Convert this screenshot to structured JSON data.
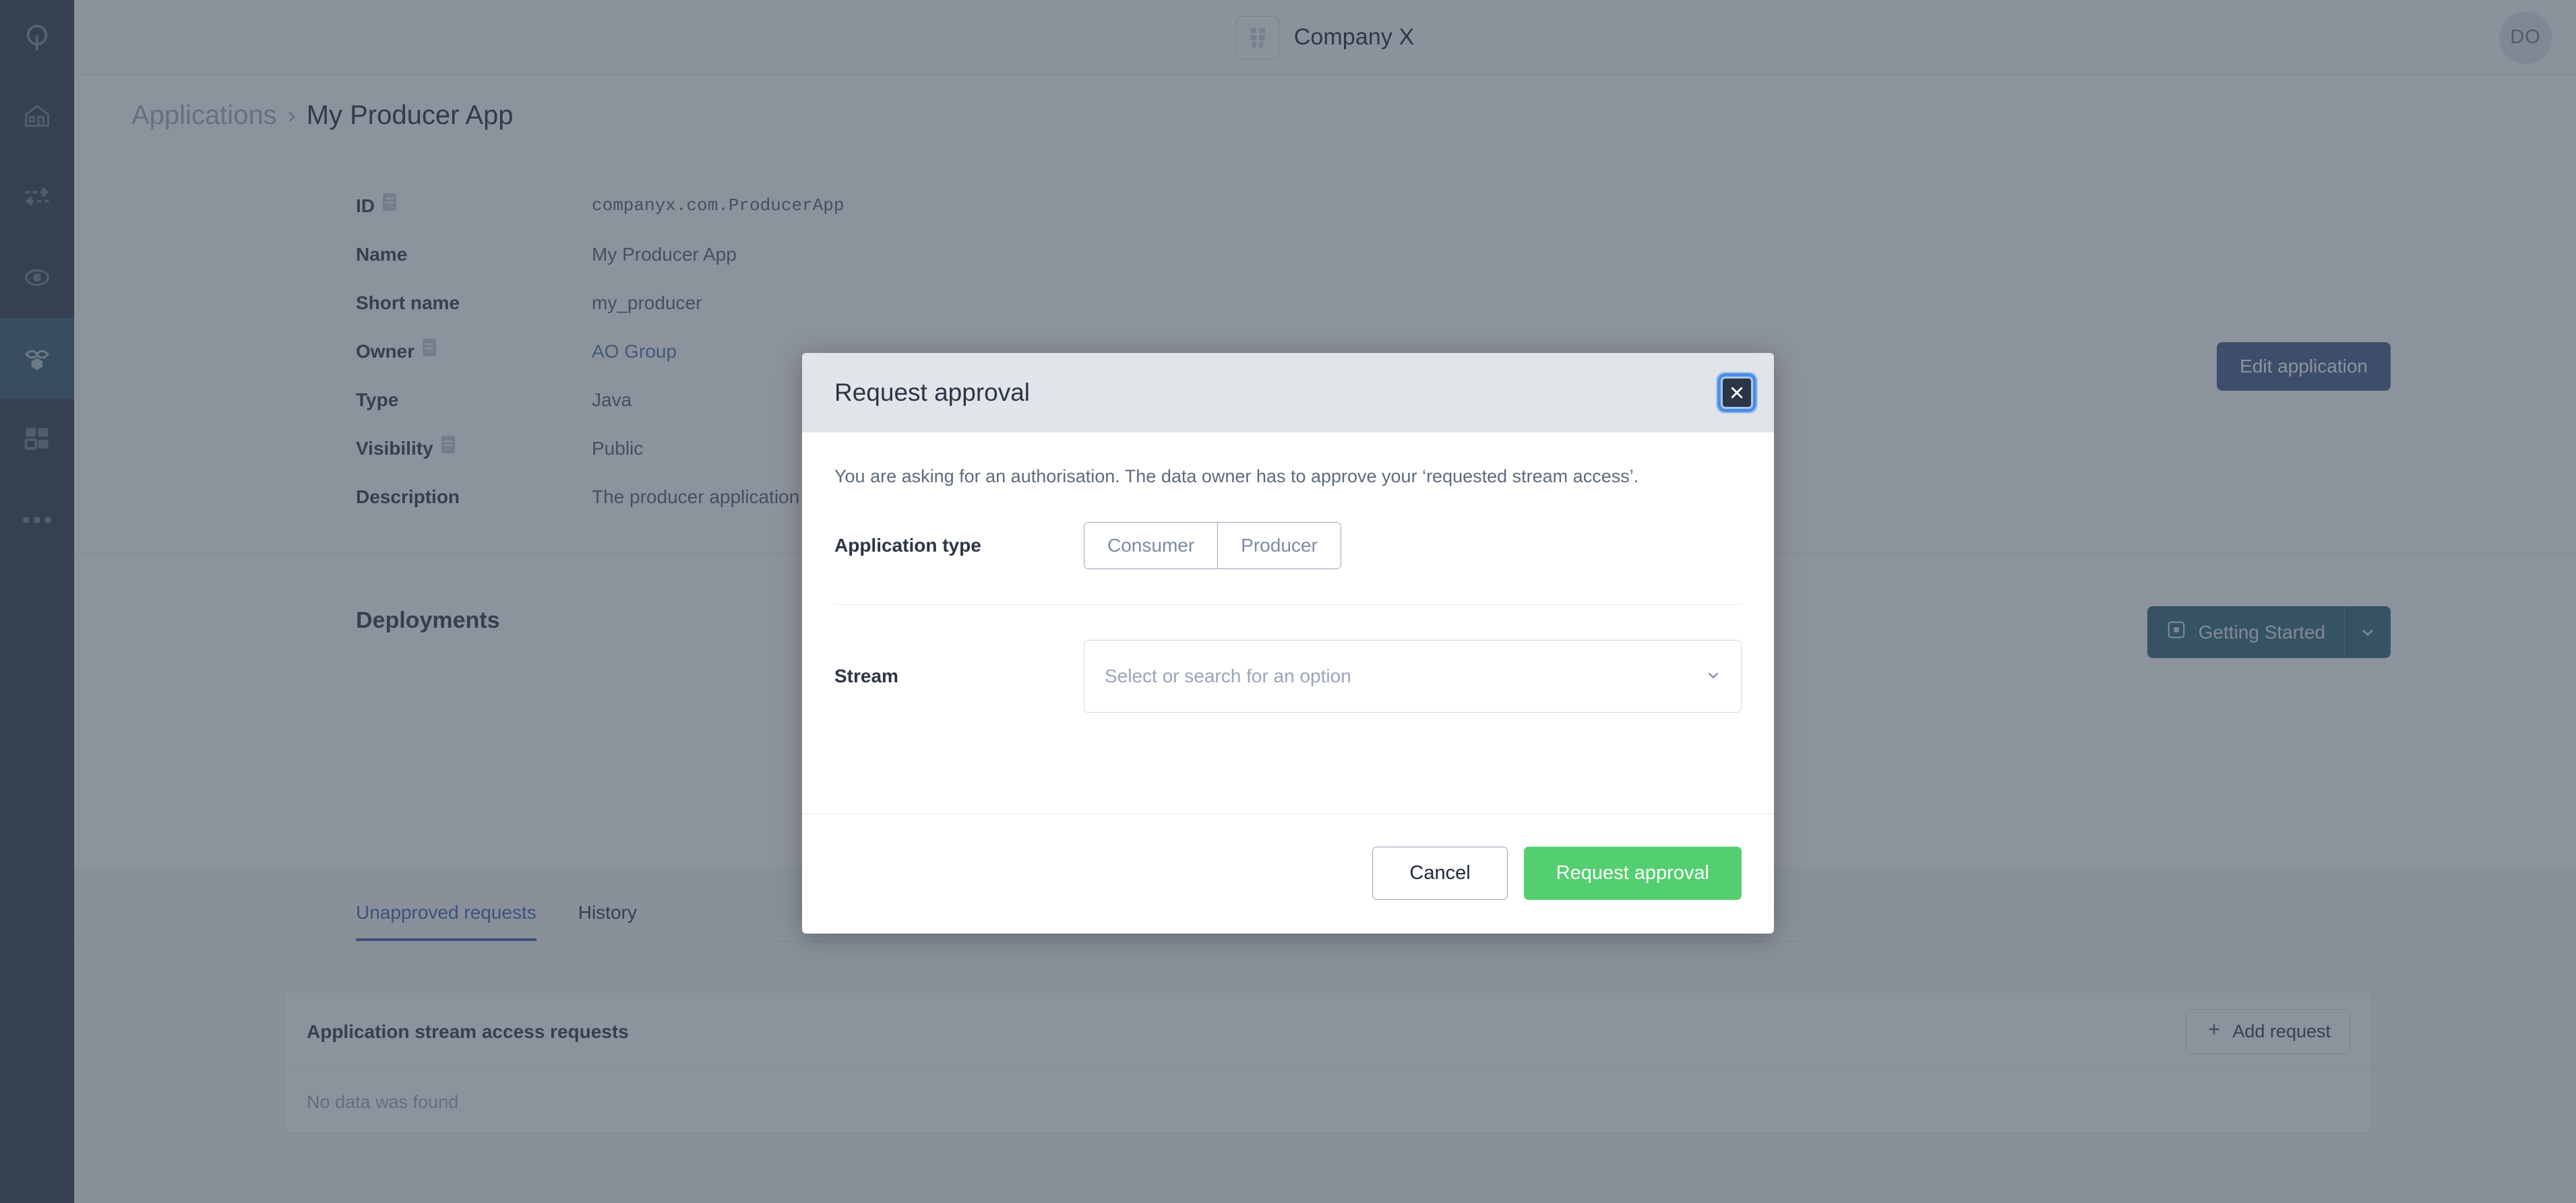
{
  "topbar": {
    "company_icon": "building-icon",
    "company_name": "Company X",
    "avatar_initials": "DO"
  },
  "sidebar": {
    "logo": "q-logo-icon",
    "items": [
      {
        "name": "home",
        "icon": "home-icon",
        "active": false
      },
      {
        "name": "data-flow",
        "icon": "exchange-arrows-icon",
        "active": false
      },
      {
        "name": "monitoring",
        "icon": "eye-icon",
        "active": false
      },
      {
        "name": "applications",
        "icon": "nodes-icon",
        "active": true
      },
      {
        "name": "catalog",
        "icon": "grid-squares-icon",
        "active": false
      },
      {
        "name": "more",
        "icon": "ellipsis-icon",
        "active": false
      }
    ]
  },
  "breadcrumb": {
    "parent": "Applications",
    "separator": "›",
    "current": "My Producer App"
  },
  "detail": {
    "rows": [
      {
        "label": "ID",
        "value": "companyx.com.ProducerApp",
        "mono": true,
        "info": true,
        "link": false
      },
      {
        "label": "Name",
        "value": "My Producer App",
        "mono": false,
        "info": false,
        "link": false
      },
      {
        "label": "Short name",
        "value": "my_producer",
        "mono": false,
        "info": false,
        "link": false
      },
      {
        "label": "Owner",
        "value": "AO Group",
        "mono": false,
        "info": true,
        "link": true
      },
      {
        "label": "Type",
        "value": "Java",
        "mono": false,
        "info": false,
        "link": false
      },
      {
        "label": "Visibility",
        "value": "Public",
        "mono": false,
        "info": true,
        "link": false
      },
      {
        "label": "Description",
        "value": "The producer application just gene",
        "mono": false,
        "info": false,
        "link": false
      }
    ],
    "edit_button": "Edit application"
  },
  "deployments": {
    "title": "Deployments",
    "getting_started_label": "Getting Started",
    "getting_started_icon": "play-square-icon",
    "caret_icon": "chevron-down-icon"
  },
  "tabs": [
    {
      "label": "Unapproved requests",
      "active": true
    },
    {
      "label": "History",
      "active": false
    }
  ],
  "requests_card": {
    "title": "Application stream access requests",
    "add_button": "Add request",
    "add_icon": "plus-icon",
    "empty_message": "No data was found"
  },
  "modal": {
    "title": "Request approval",
    "close_icon": "close-icon",
    "description": "You are asking for an authorisation. The data owner has to approve your ‘requested stream access’.",
    "application_type": {
      "label": "Application type",
      "options": [
        "Consumer",
        "Producer"
      ],
      "selected": null
    },
    "stream": {
      "label": "Stream",
      "placeholder": "Select or search for an option",
      "value": "",
      "caret_icon": "chevron-down-icon"
    },
    "cancel_label": "Cancel",
    "submit_label": "Request approval"
  },
  "colors": {
    "rail_bg": "#3c4758",
    "rail_active": "#44647b",
    "accent_blue": "#4a6fb5",
    "edit_button": "#4f6694",
    "getting_started": "#3d7281",
    "submit_green": "#54cf6f",
    "modal_header": "#e1e5ea",
    "overlay": "rgba(48,58,74,0.55)",
    "link": "#5c7cba"
  }
}
